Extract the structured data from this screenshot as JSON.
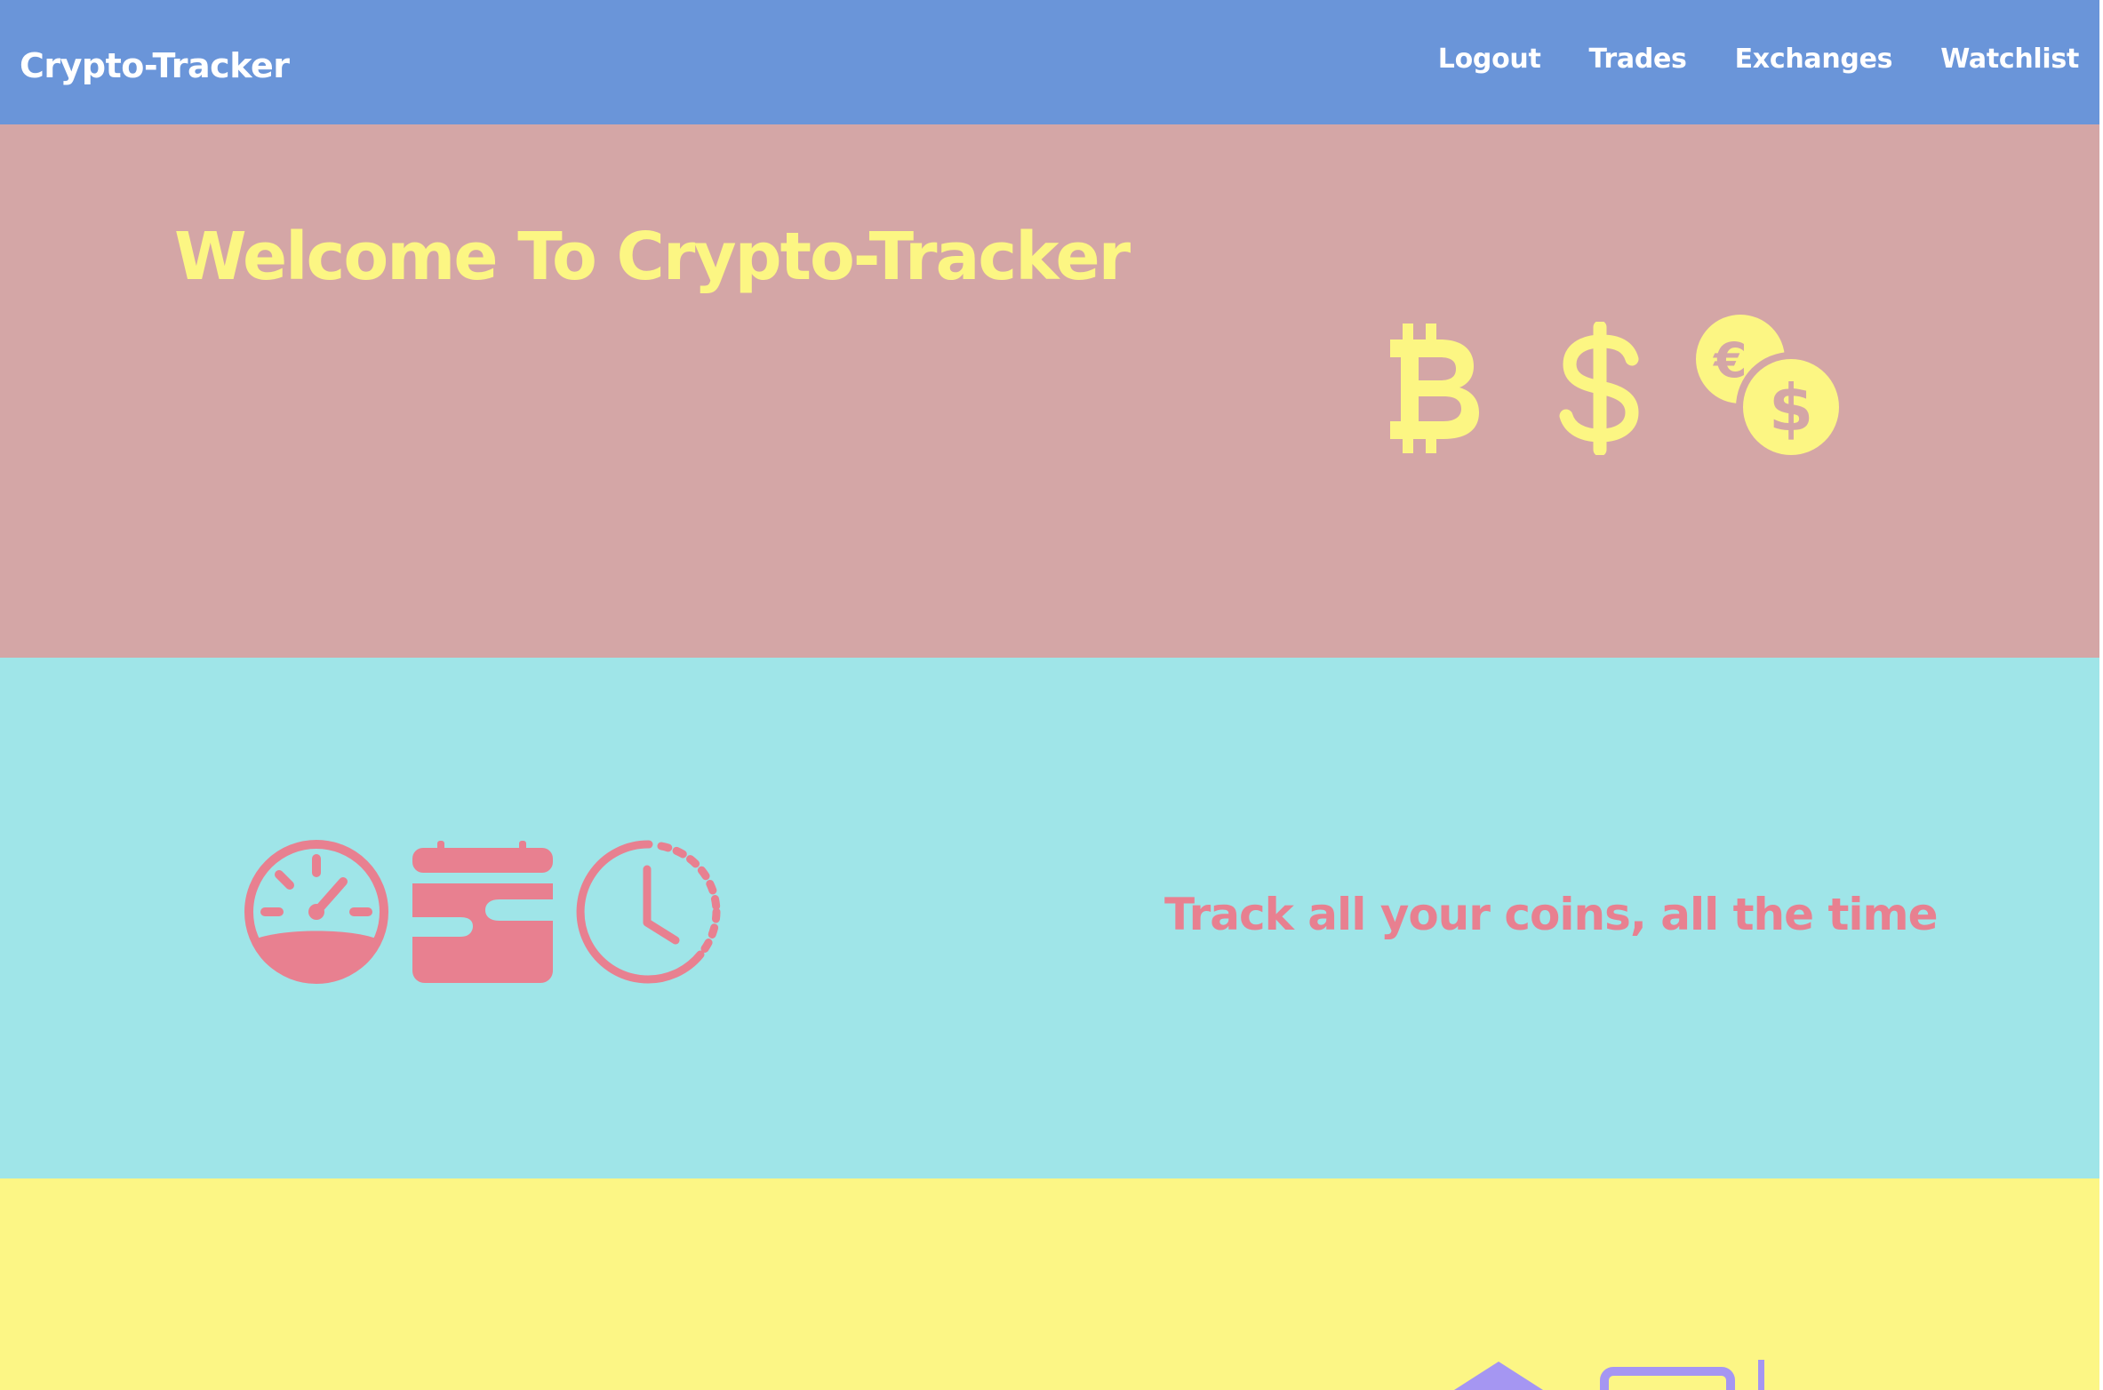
{
  "navbar": {
    "brand": "Crypto-Tracker",
    "links": [
      {
        "label": "Logout"
      },
      {
        "label": "Trades"
      },
      {
        "label": "Exchanges"
      },
      {
        "label": "Watchlist"
      }
    ]
  },
  "hero": {
    "title": "Welcome To Crypto-Tracker",
    "icons": [
      "bitcoin-icon",
      "dollar-icon",
      "coins-icon"
    ]
  },
  "features": {
    "tagline": "Track all your coins, all the time",
    "icons": [
      "speedometer-icon",
      "wallet-icon",
      "clock-icon"
    ]
  },
  "colors": {
    "navbar_bg": "#6a95d9",
    "hero_bg": "#d4a6a6",
    "hero_accent": "#fcf683",
    "features_bg": "#9fe5e8",
    "features_accent": "#e88090",
    "third_bg": "#fcf685",
    "third_accent": "#a596f2"
  }
}
